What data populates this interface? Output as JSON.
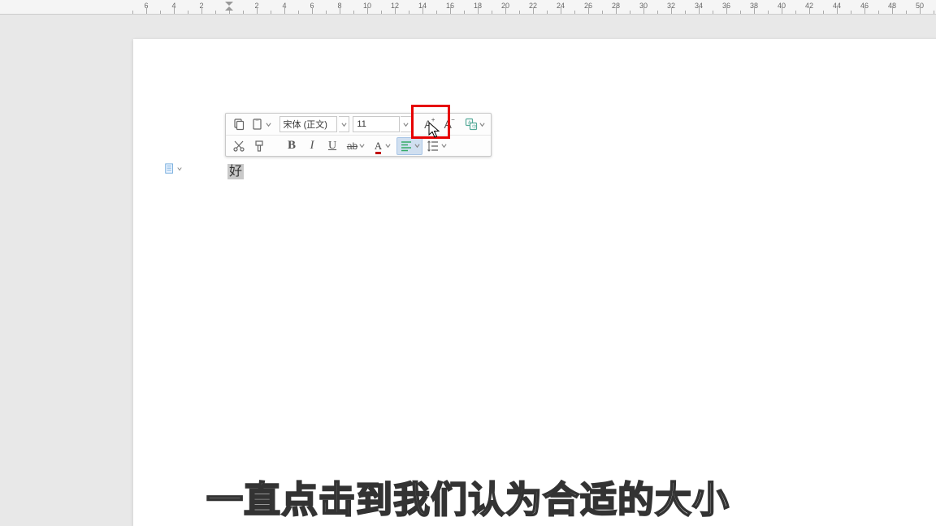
{
  "ruler": {
    "left_numbers": [
      6,
      4,
      2
    ],
    "right_numbers": [
      2,
      4,
      6,
      8,
      10,
      12,
      14,
      16,
      18,
      20,
      22,
      24,
      26,
      28,
      30,
      32,
      34,
      36,
      38,
      40,
      42,
      44,
      46,
      48,
      50
    ]
  },
  "toolbar": {
    "font_name": "宋体 (正文)",
    "font_size": "11"
  },
  "document": {
    "selected_text": "好"
  },
  "caption": "一直点击到我们认为合适的大小",
  "highlight": {
    "target": "increase-font-size-button"
  }
}
